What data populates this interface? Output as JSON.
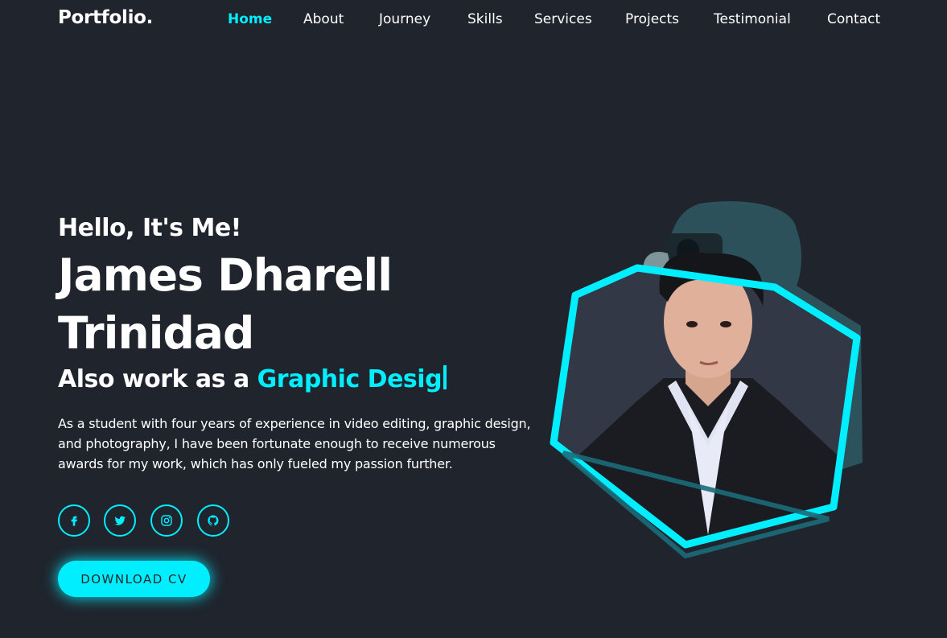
{
  "header": {
    "logo": "Portfolio.",
    "nav": [
      {
        "label": "Home",
        "active": true
      },
      {
        "label": "About"
      },
      {
        "label": "Journey"
      },
      {
        "label": "Skills"
      },
      {
        "label": "Services"
      },
      {
        "label": "Projects"
      },
      {
        "label": "Testimonial"
      },
      {
        "label": "Contact"
      }
    ]
  },
  "hero": {
    "greeting": "Hello, It's Me!",
    "name_line1": "James Dharell",
    "name_line2": "Trinidad",
    "role_prefix": "Also work as a",
    "role_typed": "Graphic Desig",
    "description": "As a student with four years of experience in video editing, graphic design, and photography, I have been fortunate enough to receive numerous awards for my work, which has only fueled my passion further.",
    "socials": [
      "facebook-icon",
      "twitter-icon",
      "instagram-icon",
      "github-icon"
    ],
    "cta_label": "DOWNLOAD CV"
  },
  "colors": {
    "background": "#1f242d",
    "accent": "#00eeff",
    "text": "#ffffff"
  }
}
